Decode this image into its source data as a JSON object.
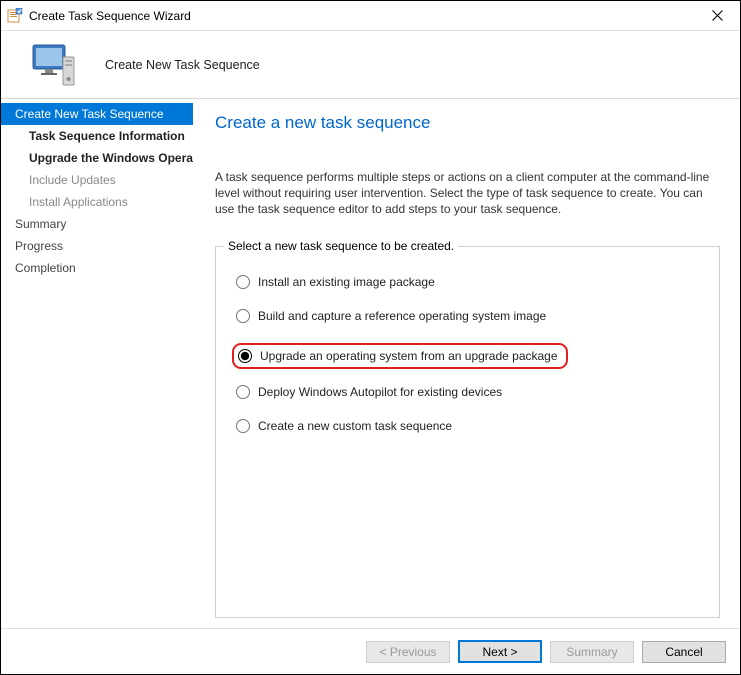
{
  "titlebar": {
    "title": "Create Task Sequence Wizard"
  },
  "header": {
    "title": "Create New Task Sequence"
  },
  "sidebar": {
    "items": [
      {
        "label": "Create New Task Sequence",
        "selected": true
      },
      {
        "label": "Task Sequence Information",
        "sub": true,
        "bold": true
      },
      {
        "label": "Upgrade the Windows Operating System",
        "sub": true,
        "bold": true
      },
      {
        "label": "Include Updates",
        "sub": true,
        "dim": true
      },
      {
        "label": "Install Applications",
        "sub": true,
        "dim": true
      },
      {
        "label": "Summary"
      },
      {
        "label": "Progress"
      },
      {
        "label": "Completion"
      }
    ]
  },
  "main": {
    "heading": "Create a new task sequence",
    "description": "A task sequence performs multiple steps or actions on a client computer at the command-line level without requiring user intervention. Select the type of task sequence to create. You can use the task sequence editor to add steps to your task sequence.",
    "legend": "Select a new task sequence to be created.",
    "options": [
      {
        "label": "Install an existing image package",
        "selected": false
      },
      {
        "label": "Build and capture a reference operating system image",
        "selected": false
      },
      {
        "label": "Upgrade an operating system from an upgrade package",
        "selected": true,
        "highlighted": true
      },
      {
        "label": "Deploy Windows Autopilot for existing devices",
        "selected": false
      },
      {
        "label": "Create a new custom task sequence",
        "selected": false
      }
    ]
  },
  "footer": {
    "previous": "< Previous",
    "next": "Next >",
    "summary": "Summary",
    "cancel": "Cancel"
  }
}
